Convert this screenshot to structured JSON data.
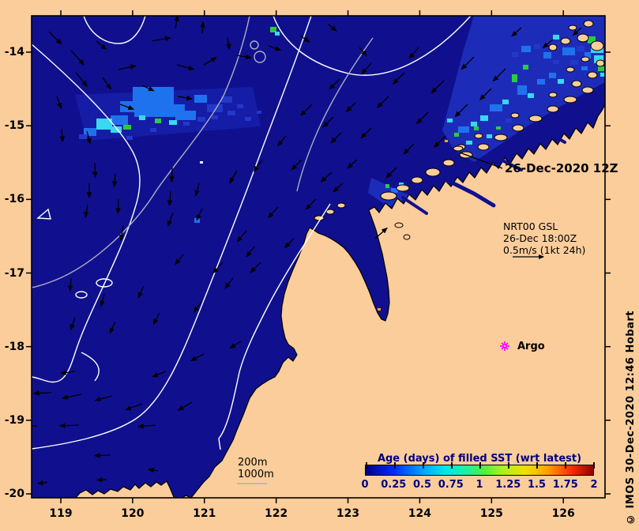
{
  "figure": {
    "date_stamp": "26-Dec-2020 12Z",
    "credit": "© IMOS 30-Dec-2020 12:46 Hobart",
    "argo_label": "Argo",
    "current_legend": {
      "line1": "NRT00 GSL",
      "line2": "26-Dec 18:00Z",
      "line3": "0.5m/s (1kt 24h)"
    },
    "depth_labels": {
      "l200": "200m",
      "l1000": "1000m"
    }
  },
  "axes": {
    "lon_ticks": [
      "119",
      "120",
      "121",
      "122",
      "123",
      "124",
      "125",
      "126"
    ],
    "lat_ticks": [
      "-14",
      "-15",
      "-16",
      "-17",
      "-18",
      "-19",
      "-20"
    ]
  },
  "colorbar": {
    "title": "Age (days) of filled SST (wrt latest)",
    "tick_labels": [
      "0",
      "0.25",
      "0.5",
      "0.75",
      "1",
      "1.25",
      "1.5",
      "1.75",
      "2"
    ]
  },
  "colors": {
    "land": "#fbcd9b",
    "ocean": "#10108e",
    "coast_water": "#1d2cb8",
    "argo_marker": "#ff00ff",
    "contour_1000m": "#ffffff",
    "contour_200m": "#b0aec0",
    "b": "#1f72ee",
    "c": "#38d8f0",
    "g": "#2bcb40",
    "n": "#2238c8",
    "o": "#ffa028",
    "y": "#f5e642",
    "w": "#e8e8ff"
  },
  "sst_patches": [
    [
      168,
      110,
      52,
      26,
      "b"
    ],
    [
      200,
      132,
      34,
      16,
      "b"
    ],
    [
      152,
      128,
      18,
      14,
      "b"
    ],
    [
      222,
      140,
      26,
      12,
      "b"
    ],
    [
      246,
      120,
      16,
      10,
      "b"
    ],
    [
      262,
      132,
      20,
      10,
      "n"
    ],
    [
      280,
      122,
      14,
      8,
      "n"
    ],
    [
      170,
      136,
      30,
      12,
      "b"
    ],
    [
      140,
      146,
      22,
      12,
      "b"
    ],
    [
      122,
      150,
      20,
      14,
      "c"
    ],
    [
      140,
      160,
      14,
      8,
      "c"
    ],
    [
      106,
      162,
      16,
      10,
      "b"
    ],
    [
      100,
      170,
      10,
      6,
      "n"
    ],
    [
      156,
      158,
      10,
      6,
      "g"
    ],
    [
      176,
      146,
      8,
      6,
      "c"
    ],
    [
      196,
      150,
      8,
      6,
      "g"
    ],
    [
      214,
      152,
      10,
      6,
      "c"
    ],
    [
      232,
      154,
      8,
      5,
      "n"
    ],
    [
      250,
      148,
      10,
      6,
      "n"
    ],
    [
      268,
      146,
      8,
      5,
      "n"
    ],
    [
      288,
      140,
      10,
      6,
      "n"
    ],
    [
      300,
      132,
      8,
      5,
      "n"
    ],
    [
      160,
      172,
      8,
      5,
      "n"
    ],
    [
      190,
      162,
      8,
      5,
      "n"
    ],
    [
      246,
      276,
      7,
      6,
      "b"
    ],
    [
      253,
      204,
      4,
      3,
      "w"
    ],
    [
      310,
      148,
      8,
      5,
      "n"
    ],
    [
      325,
      140,
      6,
      4,
      "n"
    ],
    [
      342,
      34,
      8,
      7,
      "g"
    ],
    [
      348,
      40,
      6,
      5,
      "c"
    ],
    [
      744,
      46,
      10,
      9,
      "g"
    ],
    [
      748,
      58,
      16,
      9,
      "c"
    ],
    [
      752,
      70,
      12,
      10,
      "c"
    ],
    [
      740,
      66,
      8,
      8,
      "b"
    ],
    [
      730,
      58,
      10,
      7,
      "n"
    ],
    [
      712,
      60,
      16,
      10,
      "b"
    ],
    [
      700,
      44,
      8,
      6,
      "c"
    ],
    [
      688,
      66,
      10,
      8,
      "b"
    ],
    [
      676,
      56,
      8,
      6,
      "n"
    ],
    [
      660,
      58,
      12,
      8,
      "b"
    ],
    [
      648,
      66,
      8,
      6,
      "n"
    ],
    [
      757,
      84,
      8,
      6,
      "g"
    ],
    [
      760,
      92,
      6,
      5,
      "c"
    ],
    [
      755,
      76,
      4,
      3,
      "o"
    ],
    [
      722,
      76,
      10,
      6,
      "n"
    ],
    [
      736,
      84,
      8,
      5,
      "b"
    ],
    [
      700,
      76,
      8,
      5,
      "n"
    ],
    [
      580,
      160,
      14,
      8,
      "b"
    ],
    [
      596,
      154,
      8,
      6,
      "c"
    ],
    [
      608,
      146,
      10,
      7,
      "c"
    ],
    [
      600,
      160,
      6,
      5,
      "g"
    ],
    [
      620,
      132,
      16,
      9,
      "b"
    ],
    [
      636,
      126,
      8,
      6,
      "c"
    ],
    [
      648,
      94,
      7,
      10,
      "g"
    ],
    [
      662,
      82,
      7,
      6,
      "g"
    ],
    [
      655,
      108,
      12,
      12,
      "b"
    ],
    [
      668,
      118,
      8,
      6,
      "c"
    ],
    [
      680,
      100,
      10,
      7,
      "b"
    ],
    [
      695,
      92,
      9,
      7,
      "b"
    ],
    [
      706,
      100,
      8,
      6,
      "c"
    ],
    [
      640,
      150,
      8,
      5,
      "n"
    ],
    [
      616,
      170,
      7,
      5,
      "c"
    ],
    [
      590,
      178,
      8,
      5,
      "c"
    ],
    [
      575,
      168,
      6,
      5,
      "g"
    ],
    [
      566,
      150,
      7,
      5,
      "c"
    ],
    [
      545,
      255,
      9,
      6,
      "c"
    ],
    [
      540,
      263,
      7,
      5,
      "b"
    ],
    [
      550,
      246,
      6,
      5,
      "g"
    ],
    [
      495,
      238,
      9,
      6,
      "b"
    ],
    [
      505,
      231,
      6,
      5,
      "c"
    ],
    [
      488,
      233,
      5,
      5,
      "g"
    ],
    [
      563,
      177,
      4,
      3,
      "o"
    ],
    [
      478,
      390,
      4,
      3,
      "o"
    ],
    [
      610,
      185,
      6,
      4,
      "b"
    ],
    [
      628,
      160,
      6,
      4,
      "g"
    ]
  ],
  "current_arrows": [
    [
      62,
      40,
      45,
      22
    ],
    [
      90,
      64,
      48,
      24
    ],
    [
      122,
      52,
      40,
      16
    ],
    [
      96,
      92,
      50,
      22
    ],
    [
      130,
      98,
      55,
      18
    ],
    [
      72,
      122,
      70,
      16
    ],
    [
      150,
      88,
      -12,
      22
    ],
    [
      192,
      52,
      -10,
      24
    ],
    [
      222,
      36,
      -80,
      16
    ],
    [
      256,
      42,
      -85,
      14
    ],
    [
      288,
      48,
      80,
      14
    ],
    [
      224,
      82,
      15,
      22
    ],
    [
      258,
      82,
      -30,
      18
    ],
    [
      300,
      70,
      10,
      18
    ],
    [
      340,
      58,
      20,
      16
    ],
    [
      380,
      45,
      35,
      14
    ],
    [
      225,
      122,
      10,
      18
    ],
    [
      180,
      108,
      25,
      16
    ],
    [
      152,
      132,
      20,
      18
    ],
    [
      110,
      166,
      75,
      16
    ],
    [
      78,
      163,
      85,
      16
    ],
    [
      120,
      206,
      88,
      18
    ],
    [
      113,
      232,
      90,
      18
    ],
    [
      146,
      220,
      95,
      16
    ],
    [
      150,
      252,
      92,
      18
    ],
    [
      111,
      259,
      100,
      16
    ],
    [
      156,
      286,
      100,
      18
    ],
    [
      218,
      212,
      92,
      18
    ],
    [
      216,
      242,
      95,
      18
    ],
    [
      219,
      269,
      110,
      18
    ],
    [
      252,
      232,
      105,
      16
    ],
    [
      256,
      264,
      115,
      16
    ],
    [
      300,
      216,
      120,
      18
    ],
    [
      332,
      202,
      125,
      18
    ],
    [
      362,
      172,
      130,
      16
    ],
    [
      395,
      132,
      135,
      20
    ],
    [
      422,
      148,
      135,
      18
    ],
    [
      432,
      168,
      135,
      18
    ],
    [
      382,
      202,
      135,
      18
    ],
    [
      420,
      218,
      138,
      18
    ],
    [
      400,
      252,
      135,
      18
    ],
    [
      352,
      262,
      132,
      18
    ],
    [
      312,
      292,
      130,
      18
    ],
    [
      372,
      302,
      135,
      16
    ],
    [
      330,
      332,
      135,
      18
    ],
    [
      282,
      332,
      132,
      18
    ],
    [
      232,
      322,
      128,
      16
    ],
    [
      90,
      352,
      95,
      16
    ],
    [
      132,
      372,
      105,
      16
    ],
    [
      182,
      362,
      115,
      16
    ],
    [
      95,
      402,
      110,
      16
    ],
    [
      146,
      407,
      115,
      16
    ],
    [
      202,
      396,
      118,
      16
    ],
    [
      255,
      382,
      125,
      16
    ],
    [
      295,
      352,
      128,
      16
    ],
    [
      322,
      312,
      128,
      16
    ],
    [
      65,
      497,
      178,
      22
    ],
    [
      103,
      499,
      168,
      24
    ],
    [
      142,
      501,
      165,
      22
    ],
    [
      180,
      511,
      160,
      22
    ],
    [
      243,
      509,
      150,
      20
    ],
    [
      197,
      538,
      175,
      22
    ],
    [
      100,
      538,
      178,
      24
    ],
    [
      47,
      539,
      180,
      16
    ],
    [
      140,
      576,
      178,
      20
    ],
    [
      95,
      470,
      172,
      18
    ],
    [
      60,
      610,
      170,
      12
    ],
    [
      135,
      607,
      178,
      12
    ],
    [
      200,
      596,
      190,
      12
    ],
    [
      210,
      470,
      158,
      18
    ],
    [
      258,
      448,
      152,
      18
    ],
    [
      305,
      432,
      148,
      16
    ],
    [
      475,
      302,
      -42,
      20
    ],
    [
      600,
      72,
      135,
      22
    ],
    [
      640,
      87,
      135,
      22
    ],
    [
      562,
      102,
      135,
      22
    ],
    [
      592,
      132,
      135,
      22
    ],
    [
      622,
      112,
      135,
      20
    ],
    [
      542,
      142,
      135,
      20
    ],
    [
      564,
      172,
      135,
      20
    ],
    [
      524,
      182,
      135,
      18
    ],
    [
      502,
      212,
      135,
      18
    ],
    [
      470,
      162,
      135,
      18
    ],
    [
      492,
      122,
      135,
      20
    ],
    [
      512,
      92,
      135,
      20
    ],
    [
      452,
      202,
      138,
      16
    ],
    [
      434,
      232,
      138,
      16
    ],
    [
      530,
      60,
      130,
      18
    ],
    [
      470,
      80,
      132,
      18
    ],
    [
      430,
      100,
      135,
      18
    ],
    [
      450,
      130,
      135,
      16
    ],
    [
      415,
      30,
      40,
      14
    ],
    [
      455,
      60,
      50,
      14
    ],
    [
      660,
      35,
      138,
      16
    ],
    [
      700,
      50,
      140,
      16
    ],
    [
      736,
      35,
      138,
      14
    ]
  ]
}
